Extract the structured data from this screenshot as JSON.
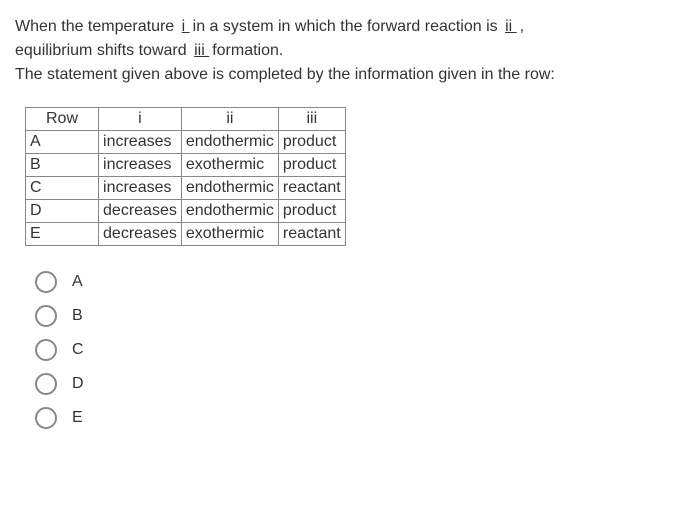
{
  "question": {
    "line1_part1": "When the temperature ",
    "blank1": "   i   ",
    "line1_part2": "in a system in which the forward reaction is ",
    "blank2": "   ii   ",
    "line1_part3": ",",
    "line2_part1": "equilibrium shifts toward ",
    "blank3": "   iii  ",
    "line2_part2": " formation.",
    "line3": "The statement given above is completed by the information given in the row:"
  },
  "table": {
    "headers": [
      "Row",
      "i",
      "ii",
      "iii"
    ],
    "rows": [
      {
        "label": "A",
        "i": "increases",
        "ii": "endothermic",
        "iii": "product"
      },
      {
        "label": "B",
        "i": "increases",
        "ii": "exothermic",
        "iii": "product"
      },
      {
        "label": "C",
        "i": "increases",
        "ii": "endothermic",
        "iii": "reactant"
      },
      {
        "label": "D",
        "i": "decreases",
        "ii": "endothermic",
        "iii": "product"
      },
      {
        "label": "E",
        "i": "decreases",
        "ii": "exothermic",
        "iii": "reactant"
      }
    ]
  },
  "options": [
    "A",
    "B",
    "C",
    "D",
    "E"
  ]
}
